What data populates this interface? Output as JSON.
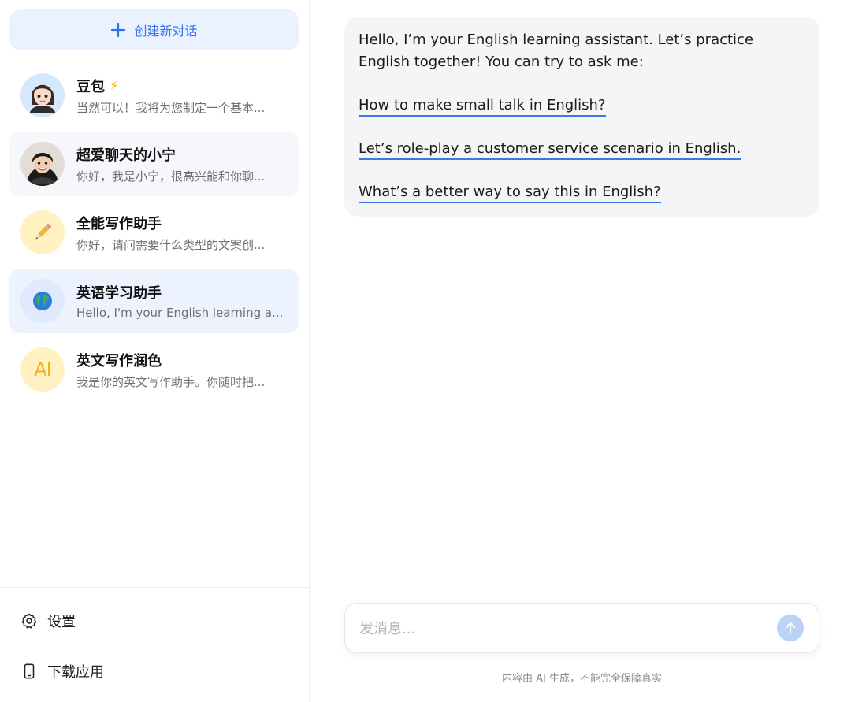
{
  "sidebar": {
    "new_chat_label": "创建新对话",
    "conversations": [
      {
        "title": "豆包",
        "subtitle": "当然可以！我将为您制定一个基本...",
        "icon": "avatar-doubao",
        "badge": "⚡",
        "state": "normal"
      },
      {
        "title": "超爱聊天的小宁",
        "subtitle": "你好，我是小宁，很高兴能和你聊...",
        "icon": "avatar-xiaoning",
        "state": "hover"
      },
      {
        "title": "全能写作助手",
        "subtitle": "你好，请问需要什么类型的文案创...",
        "icon": "pencil-icon",
        "state": "normal"
      },
      {
        "title": "英语学习助手",
        "subtitle": "Hello, I'm your English learning a...",
        "icon": "globe-icon",
        "state": "active"
      },
      {
        "title": "英文写作润色",
        "subtitle": "我是你的英文写作助手。你随时把...",
        "icon": "ai-text-icon",
        "icon_text": "AI",
        "state": "normal"
      }
    ],
    "settings_label": "设置",
    "download_label": "下载应用"
  },
  "chat": {
    "intro": "Hello, I’m your English learning assistant. Let’s practice English together! You can try to ask me:",
    "suggestions": [
      "How to make small talk in English?",
      "Let’s role-play a customer service scenario in English.",
      "What’s a better way to say this in English?"
    ]
  },
  "composer": {
    "placeholder": "发消息...",
    "disclaimer": "内容由 AI 生成，不能完全保障真实"
  },
  "colors": {
    "accent": "#2f6fec",
    "new_chat_bg": "#eaf2ff",
    "active_item_bg": "#edf3fe",
    "send_button": "#bcd3f7",
    "link_underline": "#3a78e8"
  }
}
